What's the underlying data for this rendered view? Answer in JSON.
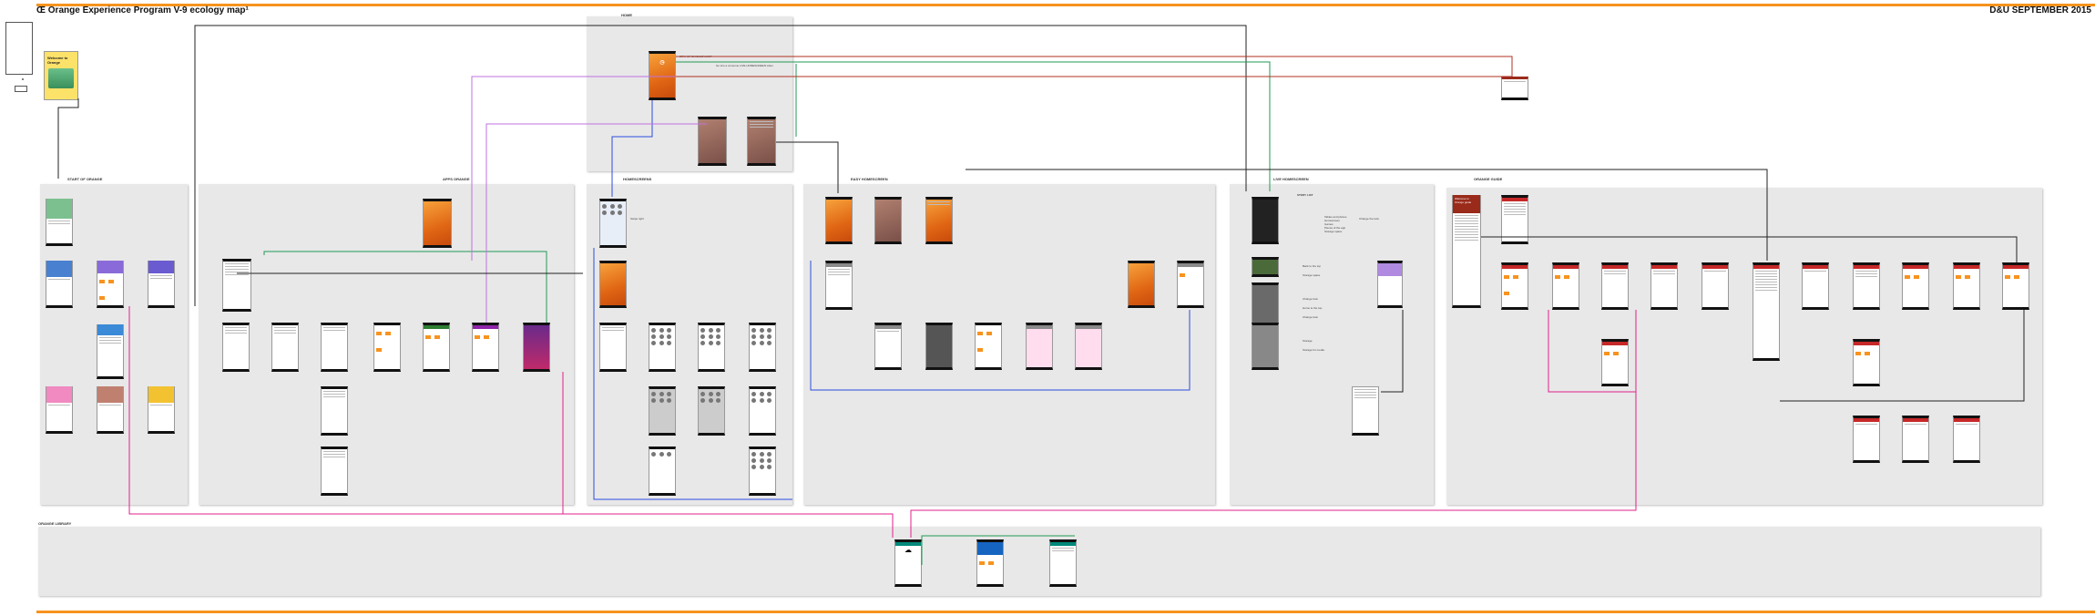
{
  "header": {
    "title": "Œ Orange Experience Program V-9 ecology map¹",
    "date": "D&U SEPTEMBER 2015"
  },
  "sections": {
    "home": "HOME",
    "start_of_orange": "START OF ORANGE",
    "apps_orange": "APPS ORANGE",
    "homescreens": "HOMESCREENS",
    "easy_homescreen": "EASY HOMESCREEN",
    "live_homescreen": "LIVE HOMESCREEN",
    "orange_guide": "ORANGE GUIDE",
    "orange_library": "ORANGE LIBRARY"
  },
  "annotations": {
    "home_note_1": "STAY UP ON BUILT LIMIT",
    "home_note_2": "Go into a consume LIVE HOMESCREEN when",
    "homescreen_note": "Swipe right",
    "welcome_card": "Welcome to Orange",
    "welcome_guide": "Welcome to Orange guide",
    "story_list": "STORY LIST",
    "live_list": [
      "Tables and photos",
      "Homescreen",
      "Games",
      "Pieces of the app",
      "Storage space"
    ],
    "live_side": "Change the look",
    "live_nav": [
      "Back to the top",
      "Storage space",
      "Change look",
      "Home to the top",
      "Change look",
      "Storage",
      "Storage for media"
    ]
  },
  "colors": {
    "orange": "#f7931e",
    "connector_dark": "#222222",
    "connector_pink": "#e0208a",
    "connector_blue": "#2c4de0",
    "connector_green": "#1f9a55",
    "connector_violet": "#c070e0",
    "connector_red": "#b03020",
    "panel": "#e8e8e8"
  }
}
